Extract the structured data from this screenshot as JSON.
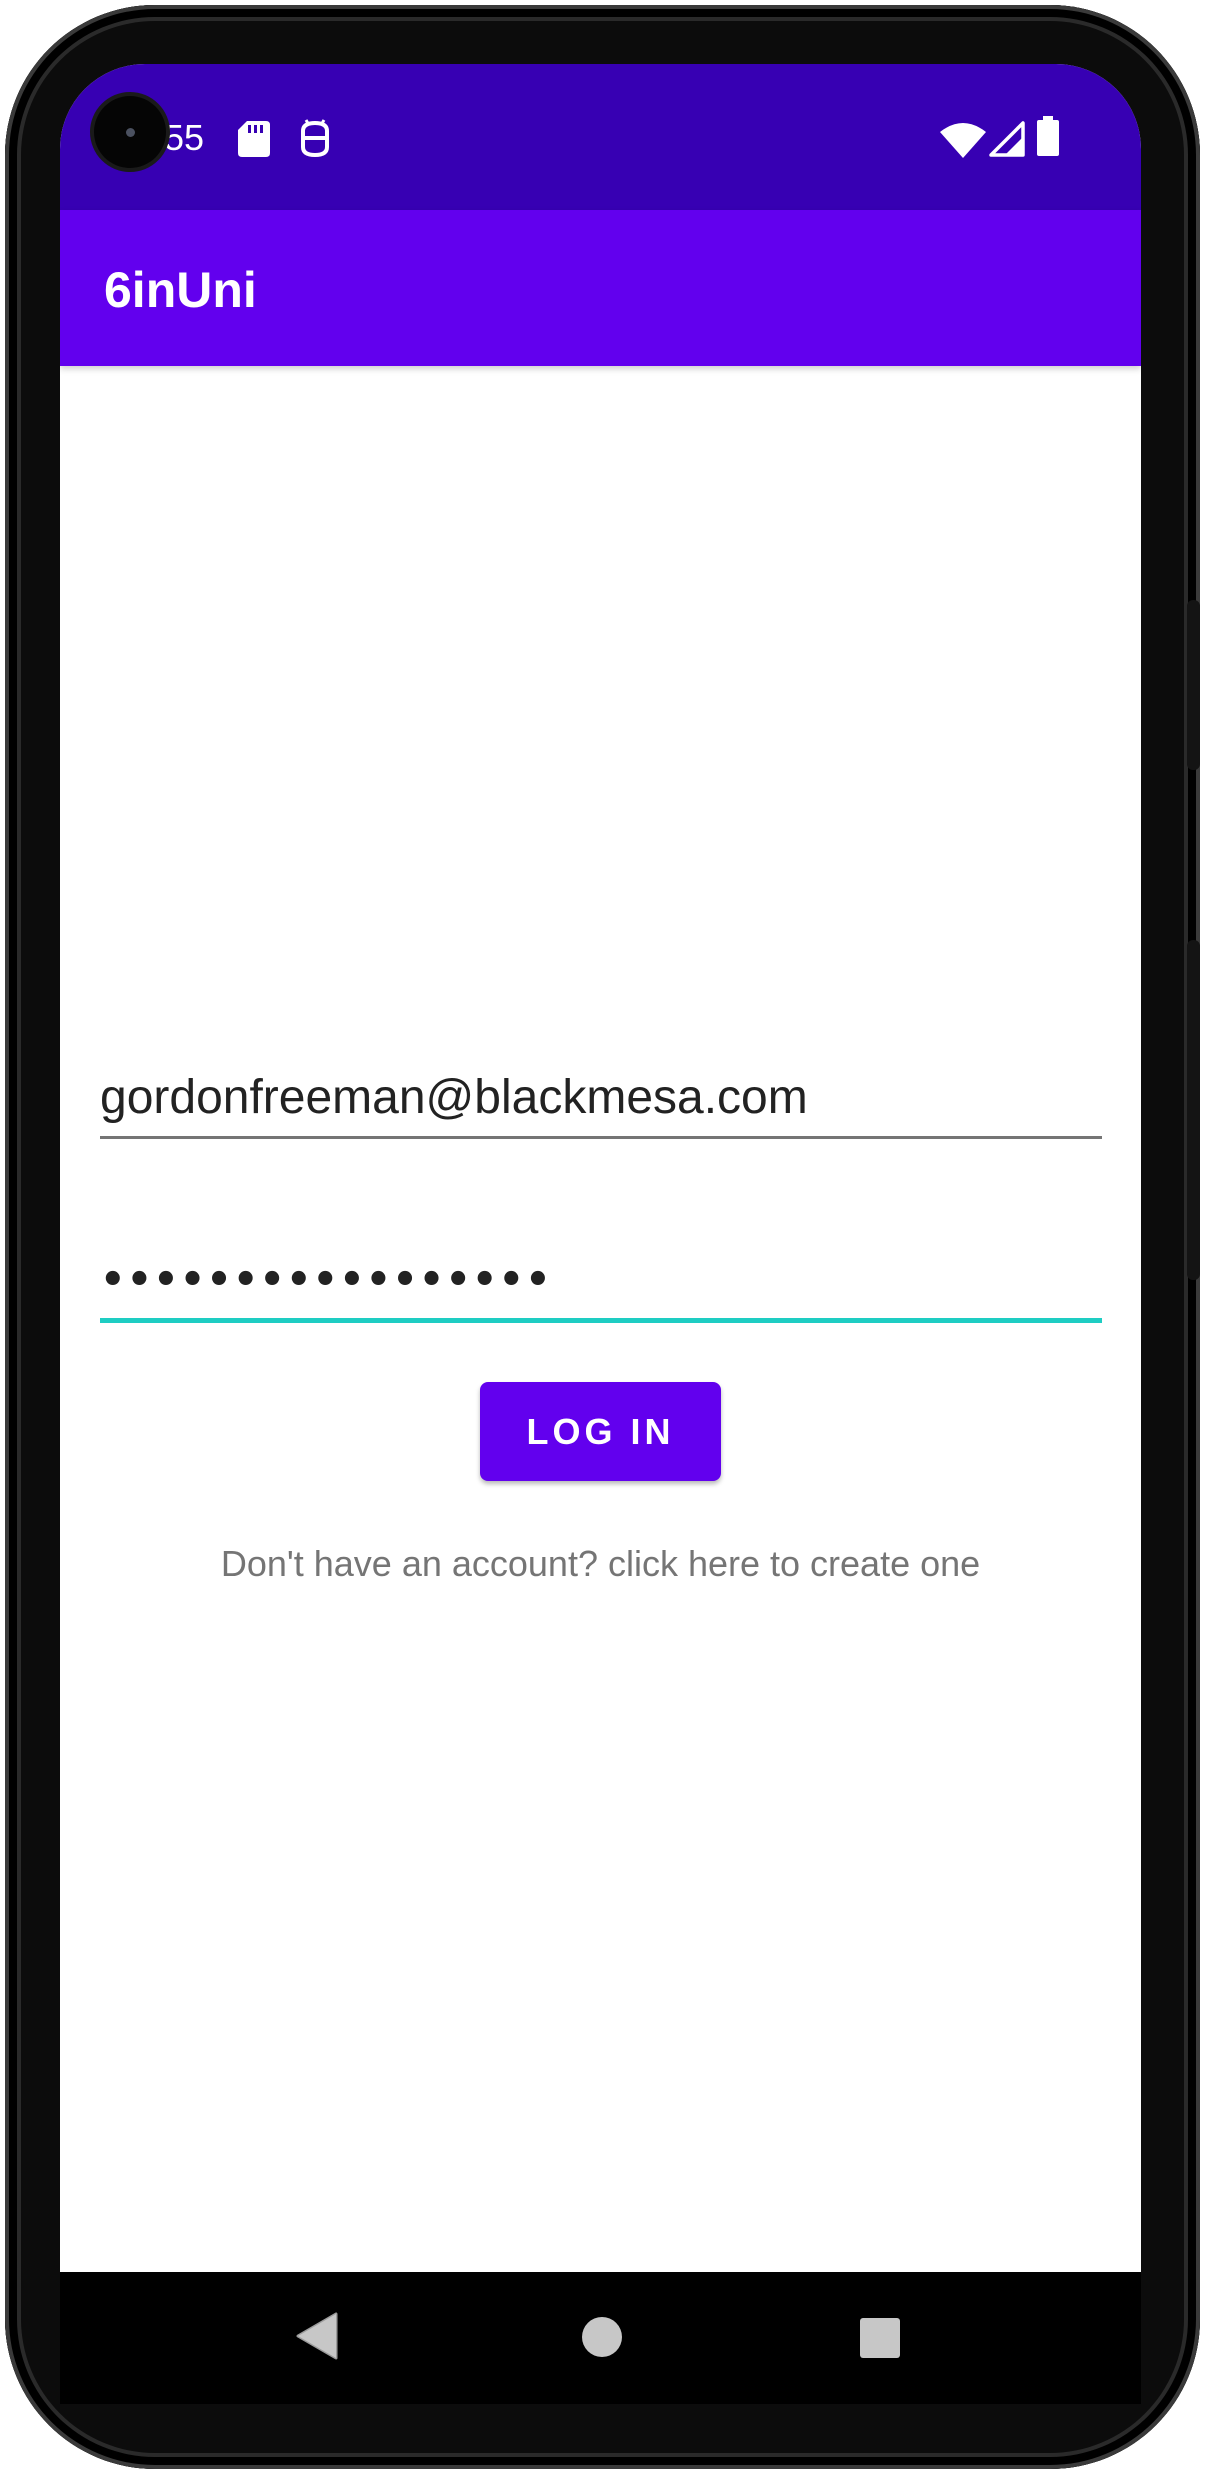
{
  "status_bar": {
    "time": "55",
    "icons": [
      "sd-card-icon",
      "debug-icon",
      "wifi-icon",
      "signal-icon",
      "battery-icon"
    ]
  },
  "app_bar": {
    "title": "6inUni"
  },
  "login_form": {
    "email_value": "gordonfreeman@blackmesa.com",
    "password_masked": "•••••••••••••••••",
    "login_button_label": "LOG IN",
    "signup_link": "Don't have an account? click here to create one"
  },
  "nav_bar": {
    "icons": [
      "back-icon",
      "home-icon",
      "recents-icon"
    ]
  },
  "colors": {
    "status_bar": "#3700b3",
    "primary": "#6200ee",
    "accent_underline": "#1ecdc3",
    "hint_text": "#757575"
  }
}
